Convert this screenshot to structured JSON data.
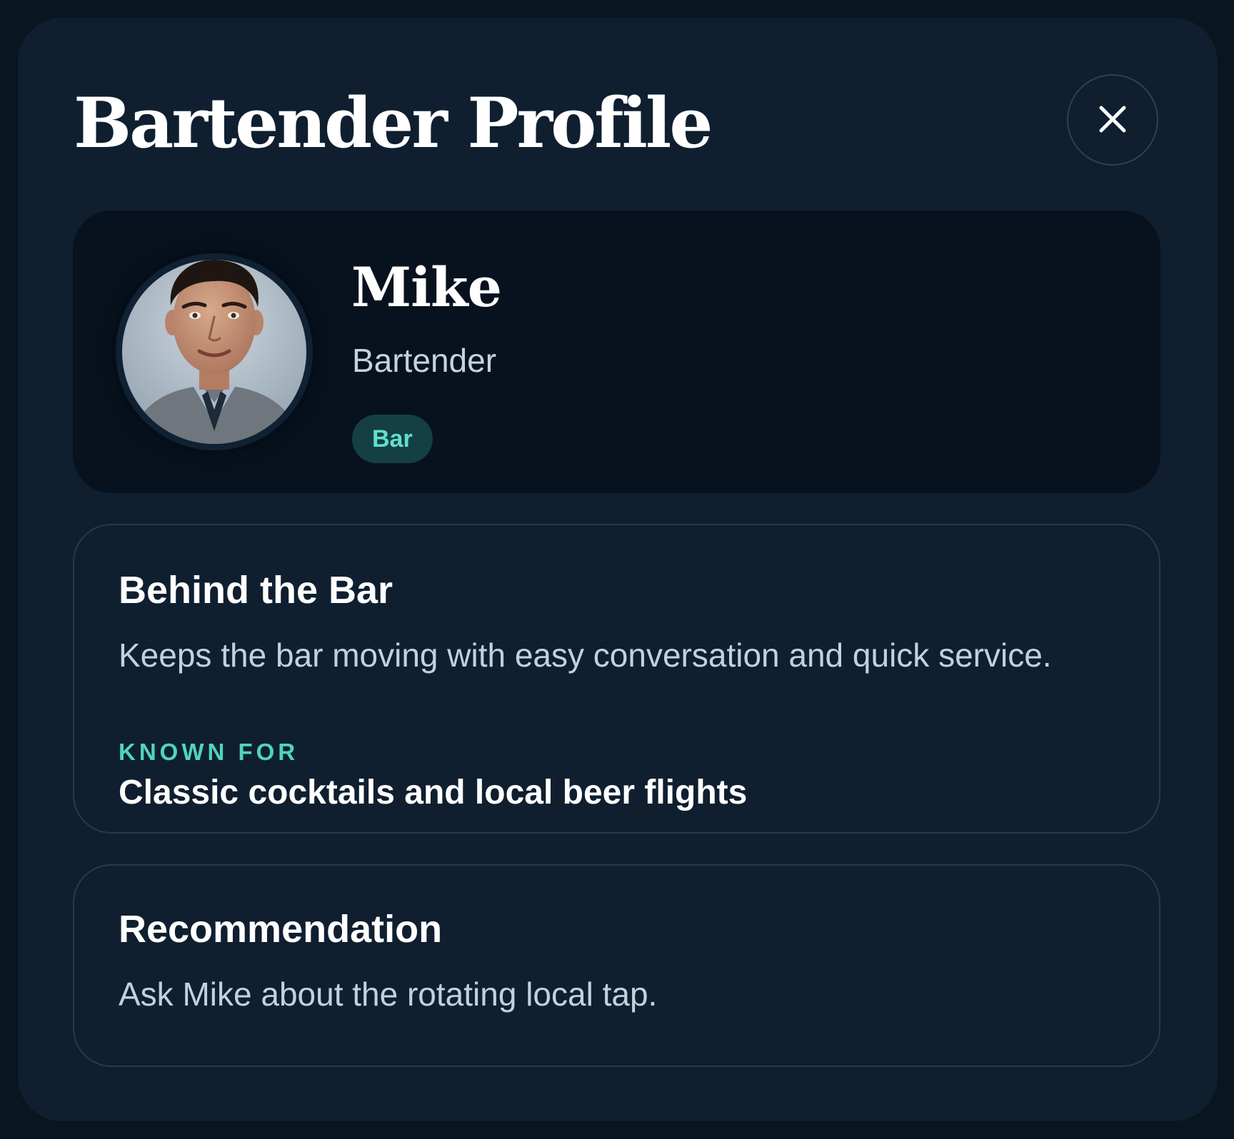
{
  "modal": {
    "title": "Bartender Profile",
    "close_icon": "close-icon"
  },
  "profile": {
    "name": "Mike",
    "role": "Bartender",
    "badge": "Bar",
    "avatar": "portrait-photo"
  },
  "behind_the_bar": {
    "heading": "Behind the Bar",
    "description": "Keeps the bar moving with easy conversation and quick service.",
    "known_for_label": "KNOWN FOR",
    "known_for_value": "Classic cocktails and local beer flights"
  },
  "recommendation": {
    "heading": "Recommendation",
    "text": "Ask Mike about the rotating local tap."
  },
  "colors": {
    "page_bg": "#09151f",
    "modal_bg": "#0f1f30",
    "card_bg": "#07121e",
    "accent": "#4fd4c3",
    "badge_bg": "#143f43",
    "border": "#243b50"
  }
}
